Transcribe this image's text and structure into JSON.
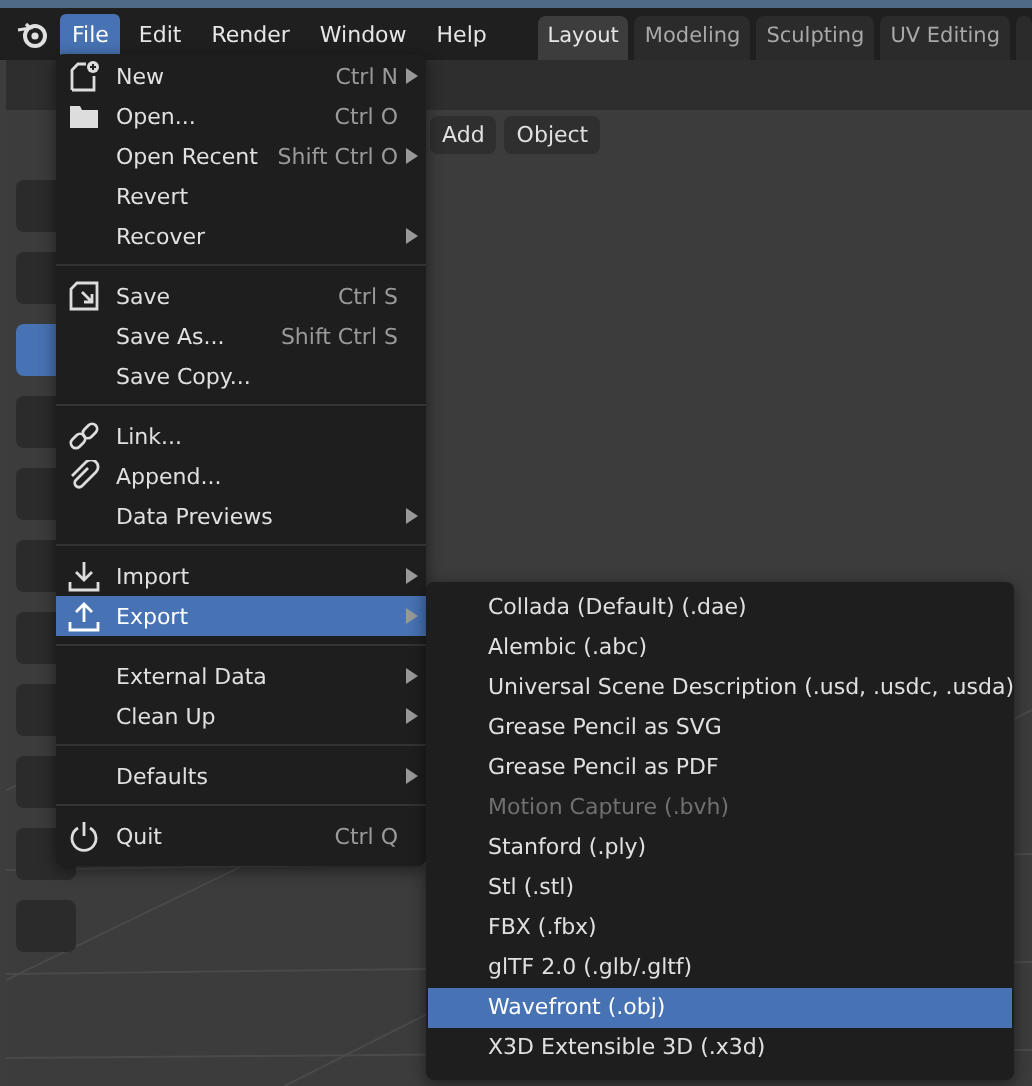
{
  "header": {
    "menus": [
      {
        "label": "File",
        "selected": true
      },
      {
        "label": "Edit",
        "selected": false
      },
      {
        "label": "Render",
        "selected": false
      },
      {
        "label": "Window",
        "selected": false
      },
      {
        "label": "Help",
        "selected": false
      }
    ],
    "workspaces": [
      {
        "label": "Layout",
        "selected": true
      },
      {
        "label": "Modeling",
        "selected": false
      },
      {
        "label": "Sculpting",
        "selected": false
      },
      {
        "label": "UV Editing",
        "selected": false
      }
    ]
  },
  "viewport": {
    "buttons": [
      "Add",
      "Object"
    ]
  },
  "file_menu": {
    "groups": [
      [
        {
          "label": "New",
          "shortcut": "Ctrl N",
          "submenu": true,
          "selected": false
        },
        {
          "label": "Open...",
          "shortcut": "Ctrl O",
          "submenu": false,
          "selected": false
        },
        {
          "label": "Open Recent",
          "shortcut": "Shift Ctrl O",
          "submenu": true,
          "selected": false
        },
        {
          "label": "Revert",
          "submenu": false,
          "selected": false
        },
        {
          "label": "Recover",
          "submenu": true,
          "selected": false
        }
      ],
      [
        {
          "label": "Save",
          "shortcut": "Ctrl S",
          "submenu": false,
          "selected": false
        },
        {
          "label": "Save As...",
          "shortcut": "Shift Ctrl S",
          "submenu": false,
          "selected": false
        },
        {
          "label": "Save Copy...",
          "submenu": false,
          "selected": false
        }
      ],
      [
        {
          "label": "Link...",
          "submenu": false,
          "selected": false
        },
        {
          "label": "Append...",
          "submenu": false,
          "selected": false
        },
        {
          "label": "Data Previews",
          "submenu": true,
          "selected": false
        }
      ],
      [
        {
          "label": "Import",
          "submenu": true,
          "selected": false
        },
        {
          "label": "Export",
          "submenu": true,
          "selected": true
        }
      ],
      [
        {
          "label": "External Data",
          "submenu": true,
          "selected": false
        },
        {
          "label": "Clean Up",
          "submenu": true,
          "selected": false
        }
      ],
      [
        {
          "label": "Defaults",
          "submenu": true,
          "selected": false
        }
      ],
      [
        {
          "label": "Quit",
          "shortcut": "Ctrl Q",
          "submenu": false,
          "selected": false
        }
      ]
    ]
  },
  "export_menu": {
    "items": [
      {
        "label": "Collada (Default) (.dae)",
        "disabled": false,
        "selected": false
      },
      {
        "label": "Alembic (.abc)",
        "disabled": false,
        "selected": false
      },
      {
        "label": "Universal Scene Description (.usd, .usdc, .usda)",
        "disabled": false,
        "selected": false
      },
      {
        "label": "Grease Pencil as SVG",
        "disabled": false,
        "selected": false
      },
      {
        "label": "Grease Pencil as PDF",
        "disabled": false,
        "selected": false
      },
      {
        "label": "Motion Capture (.bvh)",
        "disabled": true,
        "selected": false
      },
      {
        "label": "Stanford (.ply)",
        "disabled": false,
        "selected": false
      },
      {
        "label": "Stl (.stl)",
        "disabled": false,
        "selected": false
      },
      {
        "label": "FBX (.fbx)",
        "disabled": false,
        "selected": false
      },
      {
        "label": "glTF 2.0 (.glb/.gltf)",
        "disabled": false,
        "selected": false
      },
      {
        "label": "Wavefront (.obj)",
        "disabled": false,
        "selected": true
      },
      {
        "label": "X3D Extensible 3D (.x3d)",
        "disabled": false,
        "selected": false
      }
    ]
  }
}
